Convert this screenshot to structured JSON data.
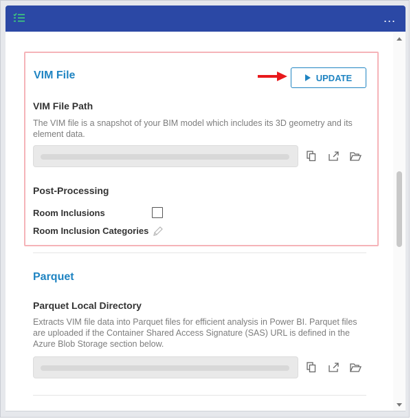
{
  "titlebar": {
    "menu_icon": "list-check-icon",
    "more_icon": "ellipsis-icon",
    "more_label": "..."
  },
  "vim_file": {
    "title": "VIM File",
    "update_label": "UPDATE",
    "path_label": "VIM File Path",
    "path_description": "The VIM file is a snapshot of your BIM model which includes its 3D geometry and its element data.",
    "post_processing_label": "Post-Processing",
    "room_inclusions_label": "Room Inclusions",
    "room_inclusions_checked": false,
    "room_inclusion_categories_label": "Room Inclusion Categories"
  },
  "parquet": {
    "title": "Parquet",
    "dir_label": "Parquet Local Directory",
    "dir_description": "Extracts VIM file data into Parquet files for efficient analysis in Power BI. Parquet files are uploaded if the Container Shared Access Signature (SAS) URL is defined in the Azure Blob Storage section below."
  },
  "field_icons": [
    "copy-icon",
    "open-external-icon",
    "folder-open-icon"
  ],
  "colors": {
    "accent": "#1f84c2",
    "titlebar": "#2b48a5",
    "highlight": "#f5b3b8",
    "arrow": "#e8191c"
  }
}
